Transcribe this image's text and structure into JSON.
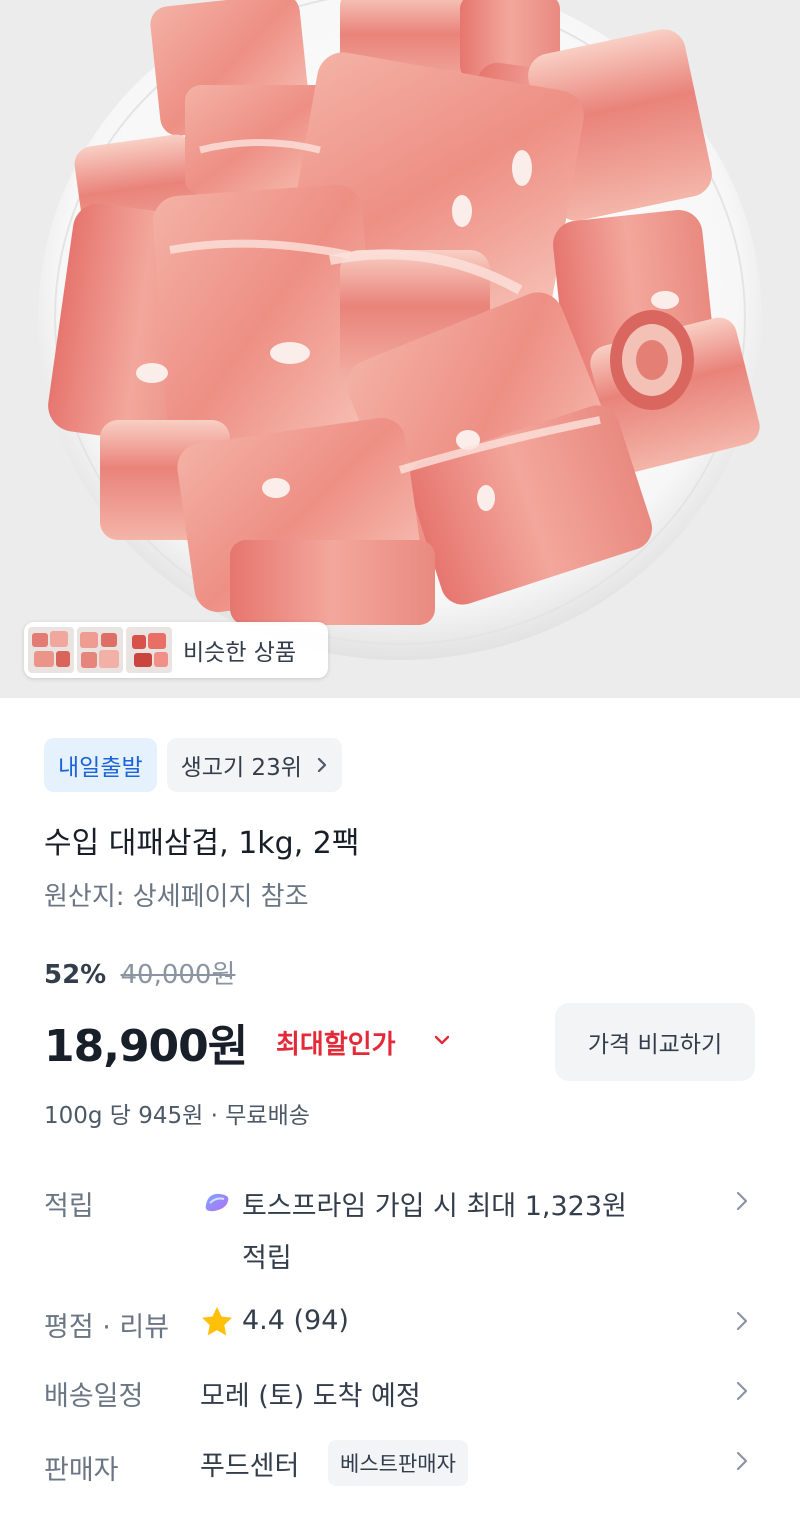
{
  "hero": {
    "image_alt": "pork belly rolls on a white plate",
    "similar_label": "비슷한 상품"
  },
  "chips": {
    "shipping": "내일출발",
    "ranking": "생고기 23위"
  },
  "product": {
    "title": "수입 대패삼겹, 1kg, 2팩",
    "origin": "원산지: 상세페이지 참조",
    "discount_rate": "52%",
    "original_price": "40,000원",
    "price": "18,900원",
    "max_discount_label": "최대할인가",
    "compare_button": "가격 비교하기",
    "unit_info": "100g 당 945원 · 무료배송"
  },
  "details": {
    "points_label": "적립",
    "points_text_1": "토스프라임 가입 시 최대 1,323원",
    "points_text_2": "적립",
    "rating_label": "평점 · 리뷰",
    "rating_value": "4.4 (94)",
    "delivery_label": "배송일정",
    "delivery_value": "모레 (토) 도착 예정",
    "seller_label": "판매자",
    "seller_value": "푸드센터",
    "seller_badge": "베스트판매자"
  },
  "colors": {
    "accent_blue": "#1b64da",
    "discount_red": "#e42939",
    "star_yellow": "#ffc107",
    "chip_bg": "#f2f4f6"
  },
  "icons": {
    "ranking_chevron": "chevron-right-icon",
    "max_discount_chevron": "chevron-down-icon",
    "points_icon": "toss-prime-icon",
    "rating_icon": "star-icon",
    "row_chevron": "chevron-right-icon"
  }
}
